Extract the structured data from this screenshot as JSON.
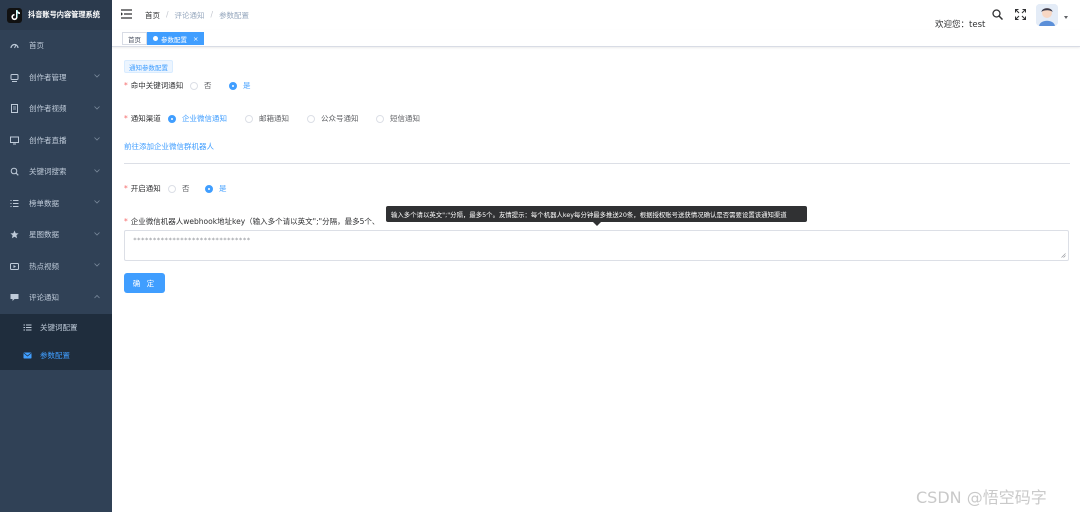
{
  "brand": {
    "title": "抖音账号内容管理系统",
    "logo_icon": "tiktok-logo"
  },
  "sidebar": {
    "items": [
      {
        "label": "首页",
        "icon": "dashboard-icon",
        "has_children": false
      },
      {
        "label": "创作者管理",
        "icon": "creator-icon",
        "has_children": true
      },
      {
        "label": "创作者视频",
        "icon": "video-doc-icon",
        "has_children": true
      },
      {
        "label": "创作者直播",
        "icon": "monitor-icon",
        "has_children": true
      },
      {
        "label": "关键词搜索",
        "icon": "search-icon",
        "has_children": true
      },
      {
        "label": "榜单数据",
        "icon": "list-icon",
        "has_children": true
      },
      {
        "label": "星图数据",
        "icon": "star-icon",
        "has_children": true
      },
      {
        "label": "热点视频",
        "icon": "hot-video-icon",
        "has_children": true
      },
      {
        "label": "评论通知",
        "icon": "message-icon",
        "has_children": true,
        "expanded": true
      }
    ],
    "sub_items": [
      {
        "label": "关键词配置",
        "icon": "list-config-icon",
        "active": false
      },
      {
        "label": "参数配置",
        "icon": "mail-icon",
        "active": true
      }
    ]
  },
  "header": {
    "breadcrumb": [
      "首页",
      "评论通知",
      "参数配置"
    ],
    "breadcrumb_separator": "/",
    "welcome_text": "欢迎您：test"
  },
  "tags": {
    "home": "首页",
    "active": "参数配置",
    "close_glyph": "×"
  },
  "form": {
    "section_button": "通知参数配置",
    "keyword_notify": {
      "label": "命中关键词通知",
      "options": [
        "否",
        "是"
      ],
      "selected": "是"
    },
    "channel": {
      "label": "通知渠道",
      "options": [
        "企业微信通知",
        "邮箱通知",
        "公众号通知",
        "短信通知"
      ],
      "selected": "企业微信通知"
    },
    "add_robot_link": "前往添加企业微信群机器人",
    "enable_notify": {
      "label": "开启通知",
      "options": [
        "否",
        "是"
      ],
      "selected": "是"
    },
    "webhook": {
      "label": "企业微信机器人webhook地址key（输入多个请以英文\";\"分隔，最多5个、",
      "value": "******************************"
    },
    "tooltip": "输入多个请以英文\";\"分隔，最多5个。友情提示：每个机器人key每分钟最多推送20条，根据授权账号送获情况确认是否需要设置该通知渠道",
    "confirm_button": "确 定"
  },
  "watermark": "CSDN @悟空码字",
  "colors": {
    "sidebar_bg": "#304156",
    "accent": "#409eff",
    "danger": "#f56c6c"
  }
}
